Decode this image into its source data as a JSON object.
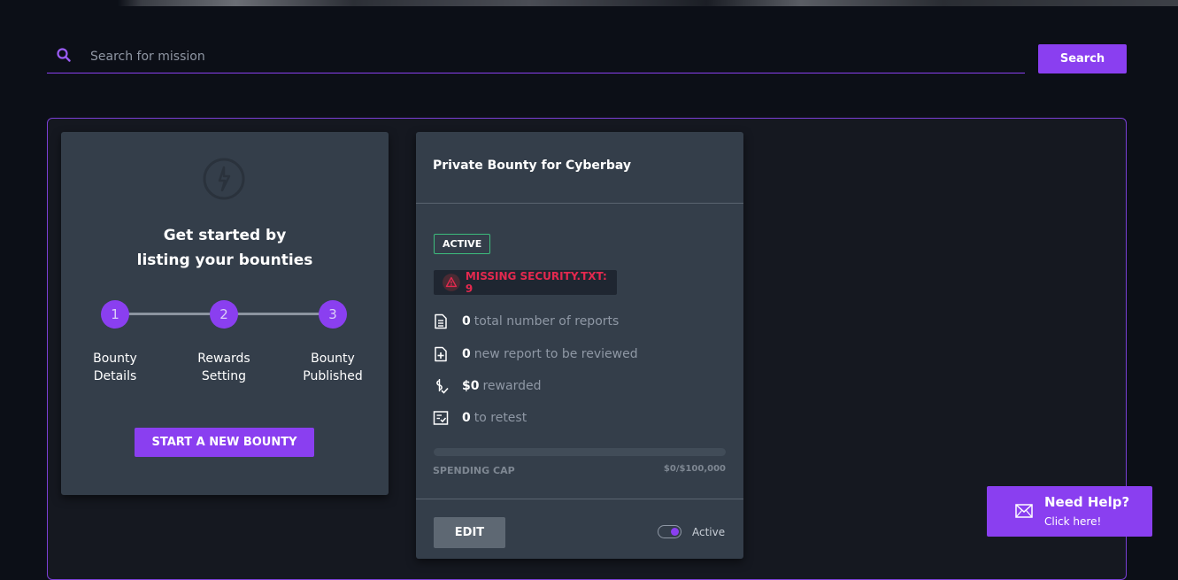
{
  "search": {
    "placeholder": "Search for mission",
    "value": "",
    "button_label": "Search",
    "icon": "search-icon"
  },
  "get_started": {
    "heading_line1": "Get started by",
    "heading_line2": "listing your bounties",
    "steps": [
      {
        "number": "1",
        "label_line1": "Bounty",
        "label_line2": "Details"
      },
      {
        "number": "2",
        "label_line1": "Rewards",
        "label_line2": "Setting"
      },
      {
        "number": "3",
        "label_line1": "Bounty",
        "label_line2": "Published"
      }
    ],
    "button_label": "START A NEW BOUNTY"
  },
  "bounty_card": {
    "title": "Private Bounty for Cyberbay",
    "status": "ACTIVE",
    "missing_security": "MISSING SECURITY.TXT: 9",
    "stats": [
      {
        "icon": "document-icon",
        "value": "0",
        "label": "total number of reports"
      },
      {
        "icon": "add-file-icon",
        "value": "0",
        "label": "new report to be reviewed"
      },
      {
        "icon": "dollar-check-icon",
        "value": "$0",
        "label": "rewarded"
      },
      {
        "icon": "checklist-icon",
        "value": "0",
        "label": "to retest"
      }
    ],
    "spending_cap_label": "SPENDING CAP",
    "spending_cap_value": "$0/$100,000",
    "spending_cap_fraction": 0,
    "edit_label": "EDIT",
    "toggle_label": "Active",
    "toggle_on": true
  },
  "help": {
    "title": "Need Help?",
    "subtitle": "Click here!"
  },
  "colors": {
    "accent": "#8a3ff0",
    "background": "#0c0f17",
    "card": "#343e4a",
    "active_green": "#3dbd7d",
    "warning_red": "#e4294f"
  }
}
